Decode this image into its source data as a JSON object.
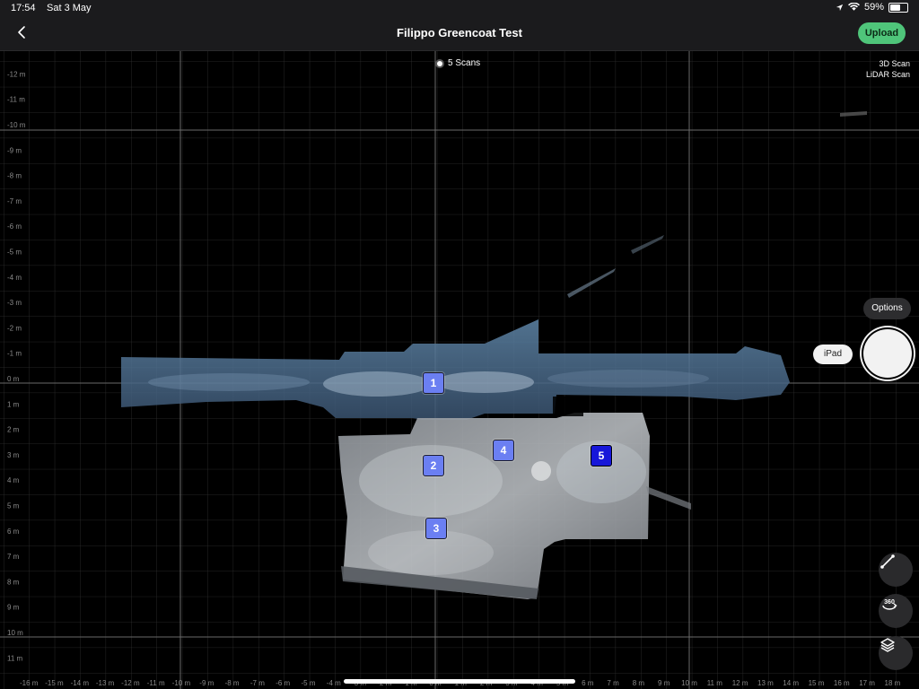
{
  "status_bar": {
    "time": "17:54",
    "date": "Sat 3 May",
    "battery": "59%",
    "battery_level": 0.59
  },
  "nav": {
    "title": "Filippo Greencoat Test",
    "upload_label": "Upload"
  },
  "map": {
    "scans_label": "5 Scans",
    "mode_line1": "3D Scan",
    "mode_line2": "LiDAR Scan",
    "y_axis_labels": [
      "-12 m",
      "-11 m",
      "-10 m",
      "-9 m",
      "-8 m",
      "-7 m",
      "-6 m",
      "-5 m",
      "-4 m",
      "-3 m",
      "-2 m",
      "-1 m",
      "0 m",
      "1 m",
      "2 m",
      "3 m",
      "4 m",
      "5 m",
      "6 m",
      "7 m",
      "8 m",
      "9 m",
      "10 m",
      "11 m"
    ],
    "x_axis_labels": [
      "-16 m",
      "-15 m",
      "-14 m",
      "-13 m",
      "-12 m",
      "-11 m",
      "-10 m",
      "-9 m",
      "-8 m",
      "-7 m",
      "-6 m",
      "-5 m",
      "-4 m",
      "-3 m",
      "-2 m",
      "-1 m",
      "0 m",
      "1 m",
      "2 m",
      "3 m",
      "4 m",
      "5 m",
      "6 m",
      "7 m",
      "8 m",
      "9 m",
      "10 m",
      "11 m",
      "12 m",
      "13 m",
      "14 m",
      "15 m",
      "16 m",
      "17 m",
      "18 m"
    ],
    "scan_pins": [
      {
        "label": "1",
        "active": false
      },
      {
        "label": "2",
        "active": false
      },
      {
        "label": "3",
        "active": false
      },
      {
        "label": "4",
        "active": false
      },
      {
        "label": "5",
        "active": true
      }
    ]
  },
  "controls": {
    "options_label": "Options",
    "device_label": "iPad",
    "capture_icon": "capture-icon",
    "measure_icon": "ruler-line-icon",
    "view360_label": "360",
    "layers_icon": "layers-icon"
  },
  "colors": {
    "upload_green": "#4fc57a",
    "pin_blue": "#6b7ff2",
    "pin_active_blue": "#1717d9",
    "background": "#000000"
  }
}
